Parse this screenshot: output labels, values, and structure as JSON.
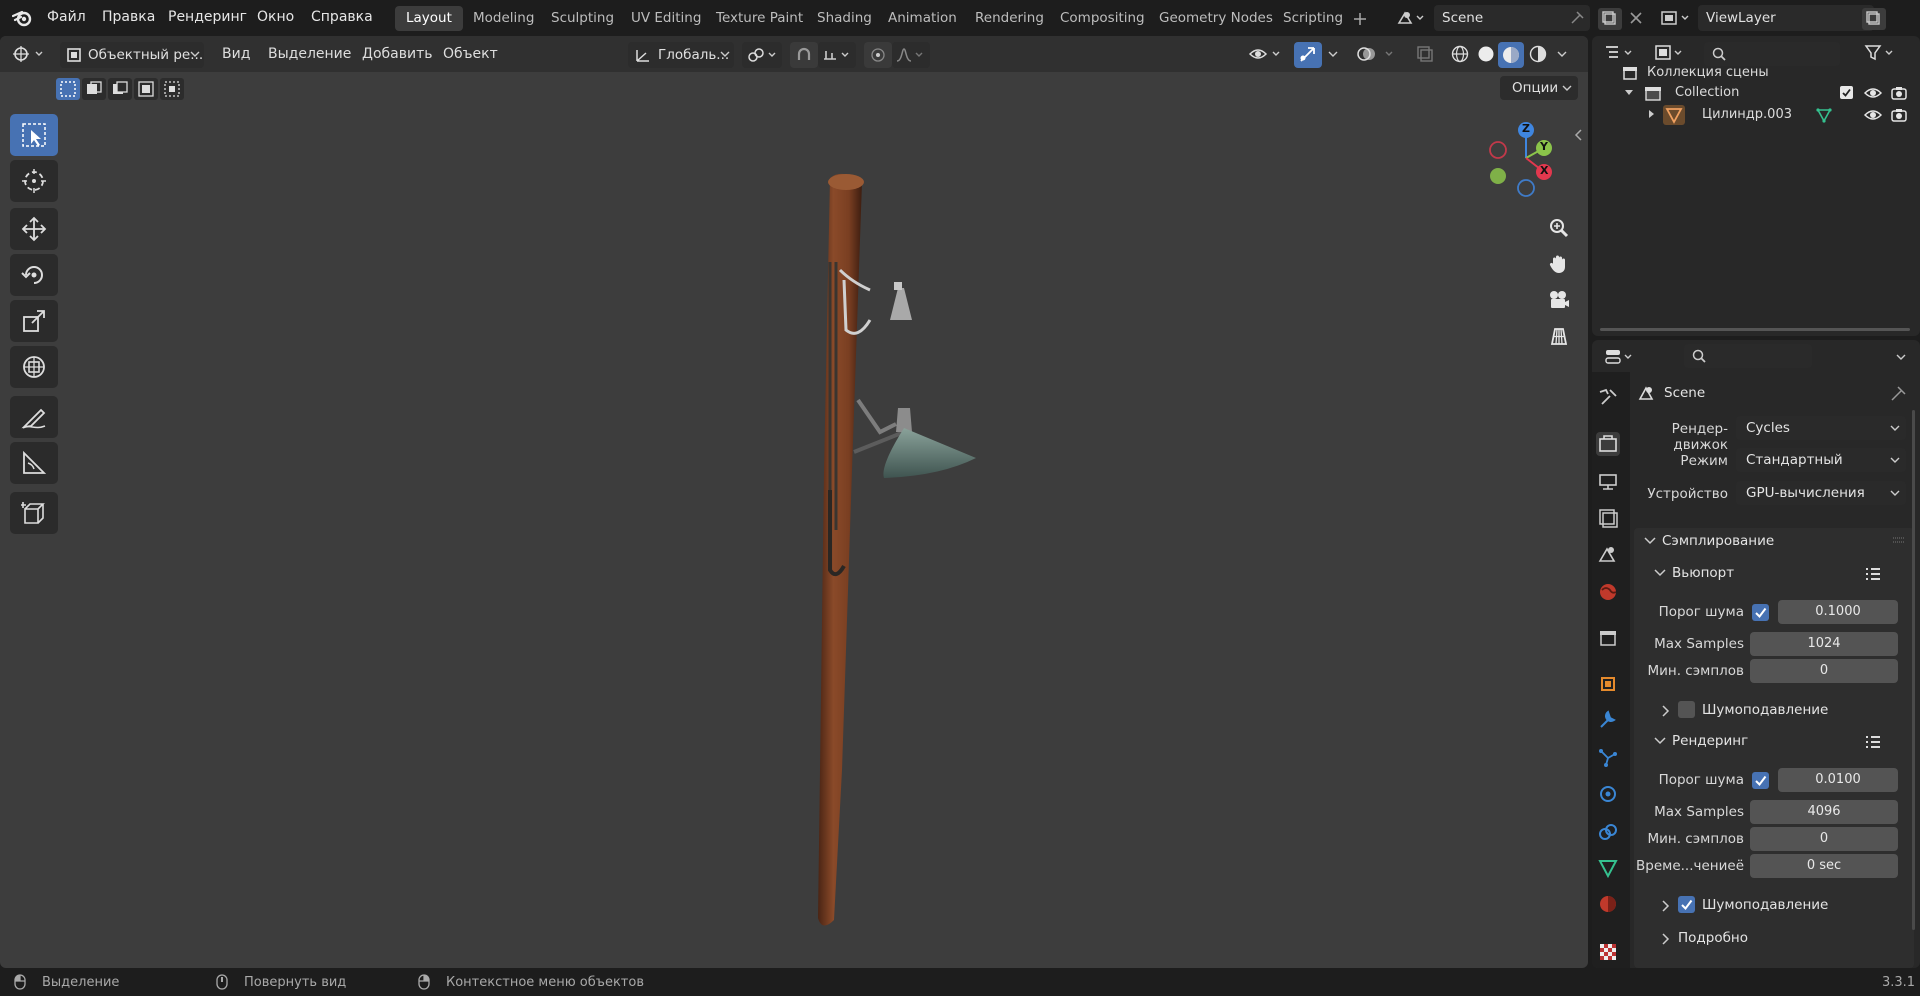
{
  "menu": {
    "file": "Файл",
    "edit": "Правка",
    "render": "Рендеринг",
    "window": "Окно",
    "help": "Справка"
  },
  "workspaces": [
    "Layout",
    "Modeling",
    "Sculpting",
    "UV Editing",
    "Texture Paint",
    "Shading",
    "Animation",
    "Rendering",
    "Compositing",
    "Geometry Nodes",
    "Scripting"
  ],
  "active_workspace": "Layout",
  "scene_name": "Scene",
  "view_layer": "ViewLayer",
  "viewport_header": {
    "mode": "Объектный ре...",
    "view": "Вид",
    "select": "Выделение",
    "add": "Добавить",
    "object": "Объект",
    "orientation": "Глобаль...",
    "options": "Опции"
  },
  "gizmo": {
    "z": "Z",
    "y": "Y",
    "x": "X"
  },
  "outliner": {
    "scene_collection": "Коллекция сцены",
    "collection": "Collection",
    "object": "Цилиндр.003"
  },
  "properties": {
    "context": "Scene",
    "render_engine_label": "Рендер-движок",
    "render_engine": "Cycles",
    "mode_label": "Режим",
    "mode": "Стандартный",
    "device_label": "Устройство",
    "device": "GPU-вычисления",
    "sampling": "Сэмплирование",
    "viewport": {
      "title": "Вьюпорт",
      "noise_threshold_label": "Порог шума",
      "noise_threshold": "0.1000",
      "max_samples_label": "Max Samples",
      "max_samples": "1024",
      "min_samples_label": "Мин. сэмплов",
      "min_samples": "0",
      "denoise": "Шумоподавление"
    },
    "render": {
      "title": "Рендеринг",
      "noise_threshold_label": "Порог шума",
      "noise_threshold": "0.0100",
      "max_samples_label": "Max Samples",
      "max_samples": "4096",
      "min_samples_label": "Мин. сэмплов",
      "min_samples": "0",
      "time_limit_label": "Време...чениеё",
      "time_limit": "0 sec",
      "denoise": "Шумоподавление"
    },
    "advanced": "Подробно"
  },
  "status": {
    "left": "Выделение",
    "middle": "Повернуть вид",
    "right": "Контекстное меню объектов",
    "version": "3.3.1"
  },
  "colors": {
    "accent": "#4772b3",
    "x_axis": "#e2384e",
    "y_axis": "#8bc44a",
    "z_axis": "#3f86e0"
  }
}
